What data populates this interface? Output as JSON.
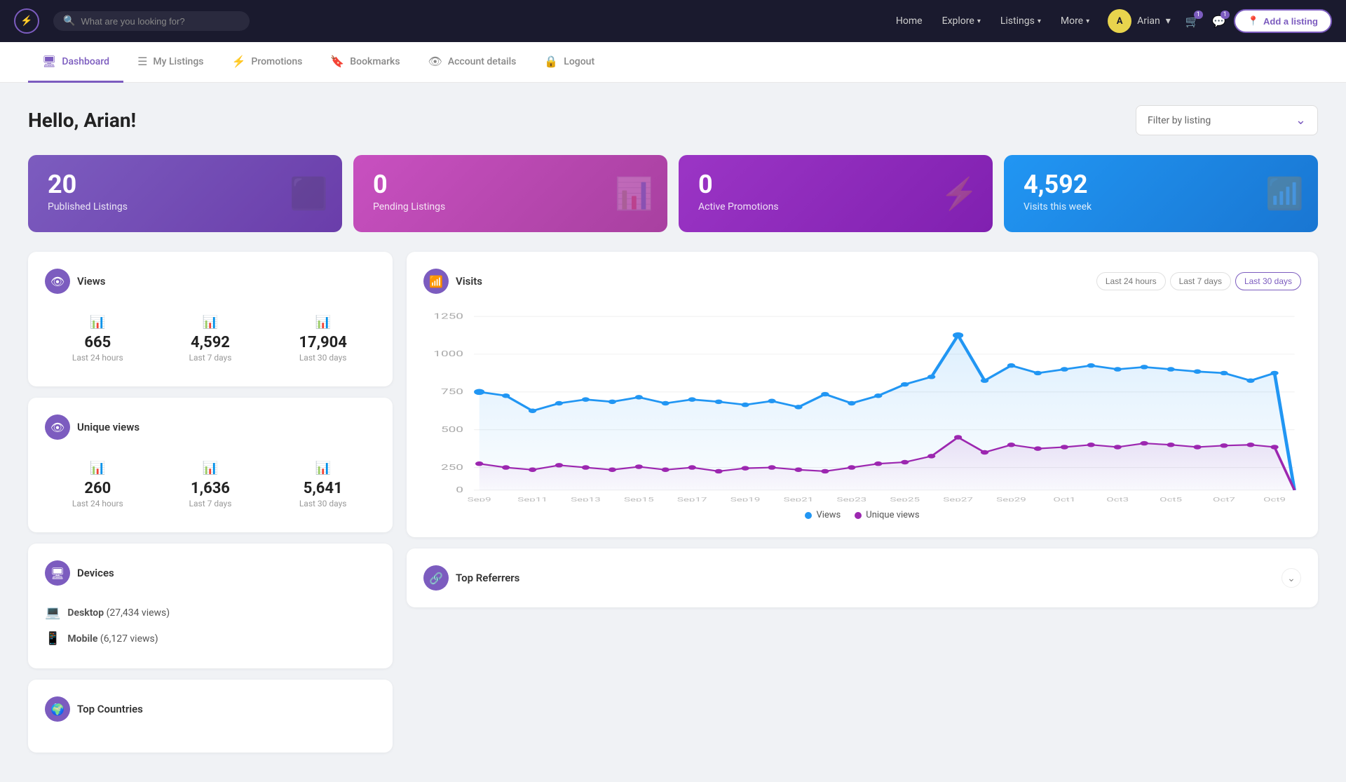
{
  "topNav": {
    "logo": "⚡",
    "search": {
      "placeholder": "What are you looking for?"
    },
    "links": [
      {
        "label": "Home",
        "hasDropdown": false
      },
      {
        "label": "Explore",
        "hasDropdown": true
      },
      {
        "label": "Listings",
        "hasDropdown": true
      },
      {
        "label": "More",
        "hasDropdown": true
      }
    ],
    "user": {
      "name": "Arian",
      "initials": "A"
    },
    "addListing": {
      "label": "Add a listing"
    }
  },
  "subNav": {
    "items": [
      {
        "id": "dashboard",
        "label": "Dashboard",
        "icon": "🖥",
        "active": true
      },
      {
        "id": "my-listings",
        "label": "My Listings",
        "icon": "☰",
        "active": false
      },
      {
        "id": "promotions",
        "label": "Promotions",
        "icon": "⚡",
        "active": false
      },
      {
        "id": "bookmarks",
        "label": "Bookmarks",
        "icon": "🔖",
        "active": false
      },
      {
        "id": "account-details",
        "label": "Account details",
        "icon": "👁",
        "active": false
      },
      {
        "id": "logout",
        "label": "Logout",
        "icon": "🔒",
        "active": false
      }
    ]
  },
  "page": {
    "title": "Hello, Arian!",
    "filterDropdown": {
      "label": "Filter by listing",
      "placeholder": "Filter by listing"
    }
  },
  "statCards": [
    {
      "id": "published",
      "number": "20",
      "label": "Published Listings",
      "colorClass": "card-purple",
      "icon": "⬜"
    },
    {
      "id": "pending",
      "number": "0",
      "label": "Pending Listings",
      "colorClass": "card-pink",
      "icon": "📊"
    },
    {
      "id": "promotions",
      "number": "0",
      "label": "Active Promotions",
      "colorClass": "card-violet",
      "icon": "⚡"
    },
    {
      "id": "visits",
      "number": "4,592",
      "label": "Visits this week",
      "colorClass": "card-blue",
      "icon": "📶"
    }
  ],
  "viewsPanel": {
    "title": "Views",
    "stats": [
      {
        "value": "665",
        "label": "Last 24 hours"
      },
      {
        "value": "4,592",
        "label": "Last 7 days"
      },
      {
        "value": "17,904",
        "label": "Last 30 days"
      }
    ]
  },
  "uniqueViewsPanel": {
    "title": "Unique views",
    "stats": [
      {
        "value": "260",
        "label": "Last 24 hours"
      },
      {
        "value": "1,636",
        "label": "Last 7 days"
      },
      {
        "value": "5,641",
        "label": "Last 30 days"
      }
    ]
  },
  "devicesPanel": {
    "title": "Devices",
    "items": [
      {
        "device": "Desktop",
        "views": "27,434 views"
      },
      {
        "device": "Mobile",
        "views": "6,127 views"
      }
    ]
  },
  "topCountriesPanel": {
    "title": "Top Countries"
  },
  "visitsChart": {
    "title": "Visits",
    "timeFilters": [
      "Last 24 hours",
      "Last 7 days",
      "Last 30 days"
    ],
    "activeFilter": "Last 30 days",
    "yLabels": [
      "0",
      "250",
      "500",
      "750",
      "1000",
      "1250"
    ],
    "legend": [
      {
        "label": "Views",
        "color": "#2196f3"
      },
      {
        "label": "Unique views",
        "color": "#9c27b0"
      }
    ]
  },
  "topReferrers": {
    "title": "Top Referrers"
  }
}
